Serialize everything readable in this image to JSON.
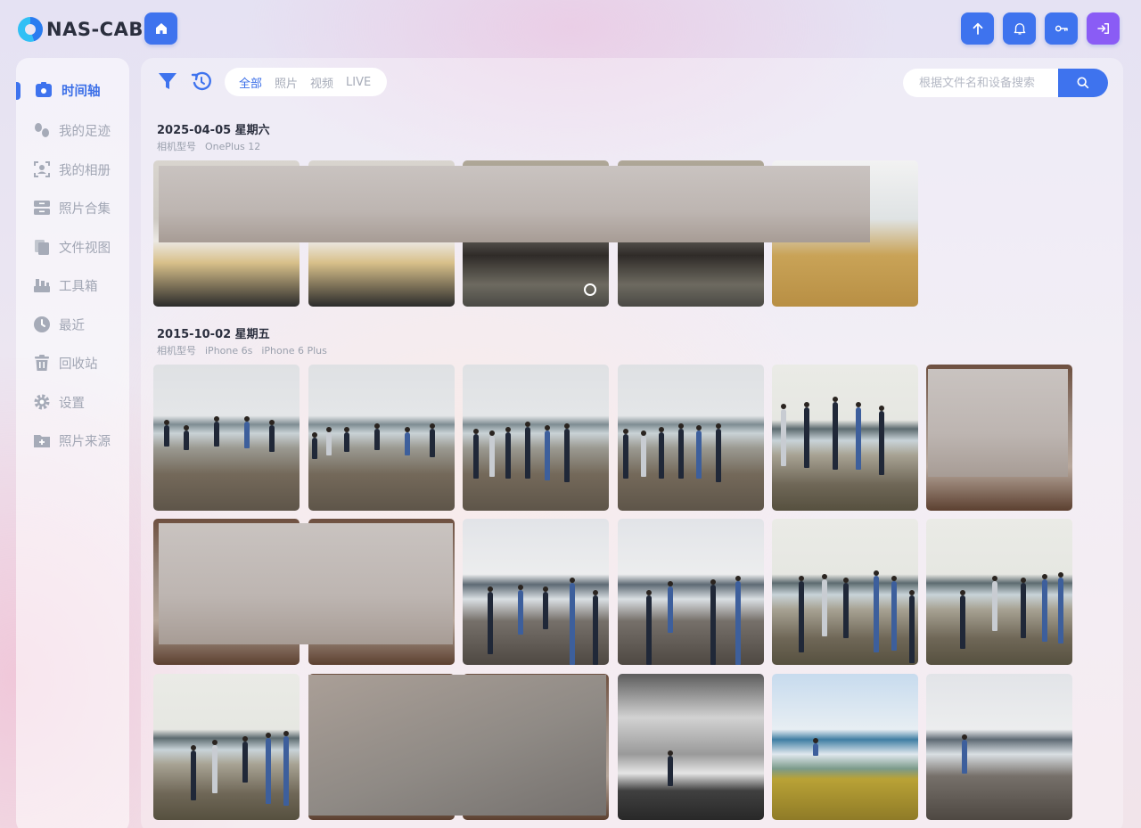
{
  "app": {
    "name": "NAS-CAB"
  },
  "header": {
    "buttons": [
      "upload-icon",
      "bell-icon",
      "key-icon",
      "logout-icon"
    ],
    "colors": {
      "accent": "#3e73ee",
      "logout": "#8a5cf5"
    }
  },
  "sidebar": {
    "items": [
      {
        "label": "时间轴",
        "icon": "photo-timeline-icon",
        "active": true
      },
      {
        "label": "我的足迹",
        "icon": "footprint-icon"
      },
      {
        "label": "我的相册",
        "icon": "face-album-icon"
      },
      {
        "label": "照片合集",
        "icon": "collection-icon"
      },
      {
        "label": "文件视图",
        "icon": "file-copy-icon"
      },
      {
        "label": "工具箱",
        "icon": "toolbox-icon"
      },
      {
        "label": "最近",
        "icon": "clock-icon"
      },
      {
        "label": "回收站",
        "icon": "trash-icon"
      },
      {
        "label": "设置",
        "icon": "gear-icon"
      },
      {
        "label": "照片来源",
        "icon": "folder-plus-icon"
      }
    ]
  },
  "toolbar": {
    "tabs": [
      "全部",
      "照片",
      "视频",
      "LIVE"
    ],
    "active_tab": "全部"
  },
  "search": {
    "placeholder": "根据文件名和设备搜索"
  },
  "groups": [
    {
      "date": "2025-04-05 星期六",
      "meta_label": "相机型号",
      "devices": [
        "OnePlus 12"
      ]
    },
    {
      "date": "2015-10-02 星期五",
      "meta_label": "相机型号",
      "devices": [
        "iPhone 6s",
        "iPhone 6 Plus"
      ]
    }
  ]
}
